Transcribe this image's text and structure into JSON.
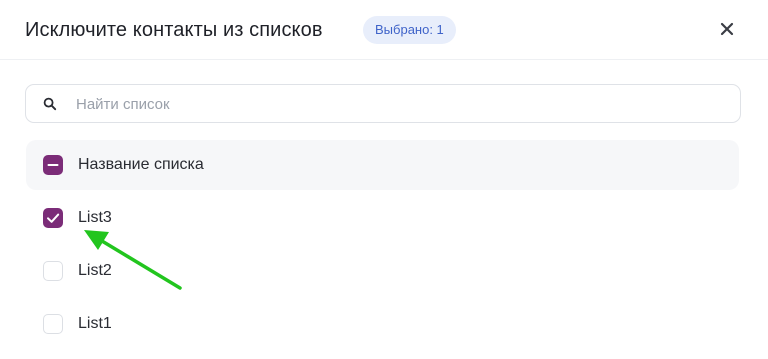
{
  "dialog": {
    "title": "Исключите контакты из списков",
    "selected_badge": "Выбрано: 1",
    "close_icon": "close-icon"
  },
  "search": {
    "placeholder": "Найти список",
    "value": "",
    "icon": "search-icon"
  },
  "list": {
    "header": {
      "label": "Название списка",
      "checkbox_state": "indeterminate"
    },
    "items": [
      {
        "label": "List3",
        "checked": true
      },
      {
        "label": "List2",
        "checked": false
      },
      {
        "label": "List1",
        "checked": false
      }
    ]
  },
  "colors": {
    "accent": "#7b2c78",
    "badge_bg": "#e8eefb",
    "badge_text": "#3f63c9",
    "annotation_arrow": "#22c51e"
  }
}
